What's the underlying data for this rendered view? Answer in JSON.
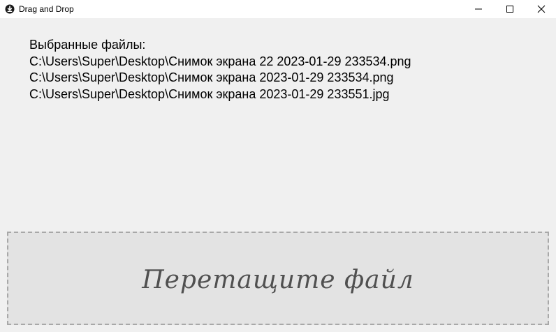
{
  "window": {
    "title": "Drag and Drop",
    "icons": {
      "app": "app-icon",
      "minimize": "minimize-icon",
      "maximize": "maximize-icon",
      "close": "close-icon"
    }
  },
  "files": {
    "heading": "Выбранные файлы:",
    "items": [
      "C:\\Users\\Super\\Desktop\\Снимок экрана 22 2023-01-29 233534.png",
      "C:\\Users\\Super\\Desktop\\Снимок экрана 2023-01-29 233534.png",
      "C:\\Users\\Super\\Desktop\\Снимок экрана 2023-01-29 233551.jpg"
    ]
  },
  "drop_zone": {
    "label": "Перетащите файл"
  },
  "colors": {
    "background": "#f0f0f0",
    "drop_zone_background": "#e3e3e3",
    "drop_zone_border": "#a8a8a8",
    "drop_text": "#505050"
  }
}
